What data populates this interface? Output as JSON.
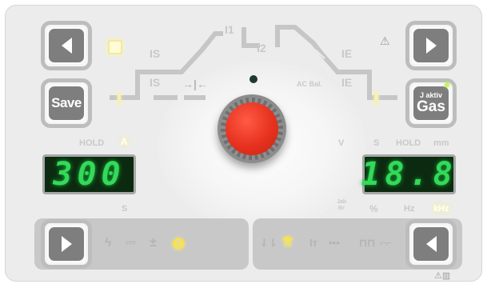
{
  "buttons": {
    "top_left_prev": "",
    "save_label": "Save",
    "top_right_next": "",
    "gas_sub_label": "J aktiv",
    "gas_label": "Gas",
    "bottom_left_next": "",
    "bottom_right_prev": ""
  },
  "sequence_labels": {
    "is_top": "IS",
    "is_bottom": "IS",
    "i1": "I1",
    "i2": "I2",
    "ie_top": "IE",
    "ie_bottom": "IE",
    "ac_bal": "AC Bal."
  },
  "left_display": {
    "hold_label": "HOLD",
    "unit_label": "A",
    "value": "300",
    "below_label": "S"
  },
  "right_display": {
    "v_label": "V",
    "s_label": "S",
    "hold_label": "HOLD",
    "mm_label": "mm",
    "value": "18.8",
    "jab_label": "Jab",
    "br_label": "Br",
    "percent_label": "%",
    "hz_label": "Hz",
    "khz_label": "kHz"
  },
  "mode_bar_left": {
    "icons": [
      "lightning-icon",
      "dc-icon",
      "plus-minus-icon",
      "ac-sine-icon"
    ],
    "active": "ac-sine-icon"
  },
  "mode_bar_right": {
    "icons": [
      "two-stroke-icon",
      "four-stroke-icon",
      "spot-icon",
      "dots-icon",
      "pulse-icon",
      "foot-pedal-icon"
    ],
    "active": "four-stroke-icon"
  },
  "colors": {
    "display_digits": "#34d95a",
    "knob": "#e6321f",
    "active_indicator": "#ffe23a"
  }
}
